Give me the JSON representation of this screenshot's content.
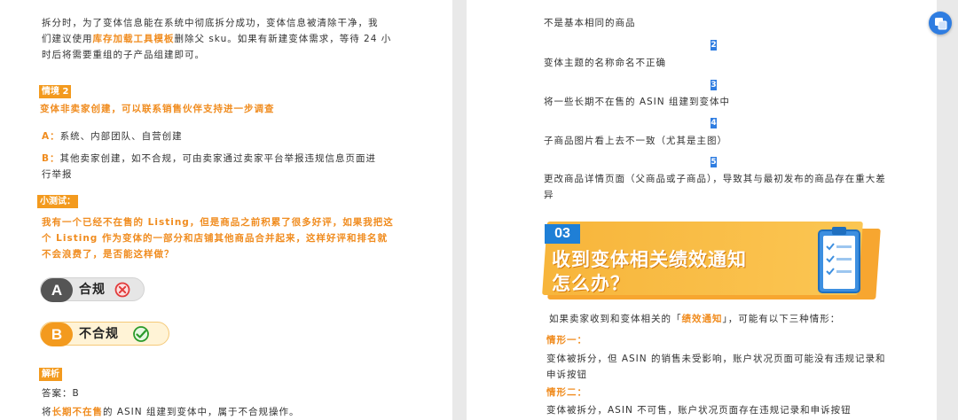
{
  "left": {
    "p1_line1": "拆分时，为了变体信息能在系统中彻底拆分成功，变体信息被清除干净，我",
    "p1_line2_a": "们建议使用",
    "p1_line2_link": "库存加载工具模板",
    "p1_line2_b": "删除父 sku。如果有新建变体需求，等待 24 小",
    "p1_line3": "时后将需要重组的子产品组建即可。",
    "scenario2_tag": "情境 2",
    "scenario2_title": "变体非卖家创建，可以联系销售伙伴支持进一步调查",
    "a_prefix": "A：",
    "a_text": "系统、内部团队、自营创建",
    "b_prefix": "B：",
    "b_text1": "其他卖家创建，如不合规，可由卖家通过卖家平台举报违规信息页面进",
    "b_text2": "行举报",
    "quiz_tag": "小测试：",
    "quiz_line1": "我有一个已经不在售的 Listing，但是商品之前积累了很多好评，如果我把这",
    "quiz_line2": "个 Listing 作为变体的一部分和店铺其他商品合并起来，这样好评和排名就",
    "quiz_line3": "不会浪费了，是否能这样做？",
    "option_a_letter": "A",
    "option_a_text": "合规",
    "option_b_letter": "B",
    "option_b_text": "不合规",
    "analysis_tag": "解析",
    "answer": "答案：B",
    "last_a": "将",
    "last_hl": "长期不在售",
    "last_b": "的 ASIN 组建到变体中，属于不合规操作。"
  },
  "right": {
    "item1_text": "不是基本相同的商品",
    "item2_num": "2",
    "item2_text": "变体主题的名称命名不正确",
    "item3_num": "3",
    "item3_text": "将一些长期不在售的 ASIN 组建到变体中",
    "item4_num": "4",
    "item4_text": "子商品图片看上去不一致（尤其是主图）",
    "item5_num": "5",
    "item5_text1": "更改商品详情页面（父商品或子商品），导致其与最初发布的商品存在重大差",
    "item5_text2": "异",
    "banner_num": "03",
    "banner_line1": "收到变体相关绩效通知",
    "banner_line2": "怎么办？",
    "intro_a": "如果卖家收到和变体相关的「",
    "intro_hl": "绩效通知",
    "intro_b": "」，可能有以下三种情形：",
    "case1_label": "情形一：",
    "case1_text1": "变体被拆分，但 ASIN 的销售未受影响，账户状况页面可能没有违规记录和",
    "case1_text2": "申诉按钮",
    "case2_label": "情形二：",
    "case2_text": "变体被拆分，ASIN 不可售，账户状况页面存在违规记录和申诉按钮"
  },
  "colors": {
    "accent_orange": "#f39a1e",
    "badge_blue": "#2f7de1",
    "option_a_gray": "#555555",
    "option_b_orange": "#f39a1e"
  },
  "icons": {
    "option_a_icon": "x-circle-icon",
    "option_b_icon": "check-circle-icon",
    "banner_icon": "checklist-clipboard-icon",
    "floating_icon": "translate-icon"
  }
}
